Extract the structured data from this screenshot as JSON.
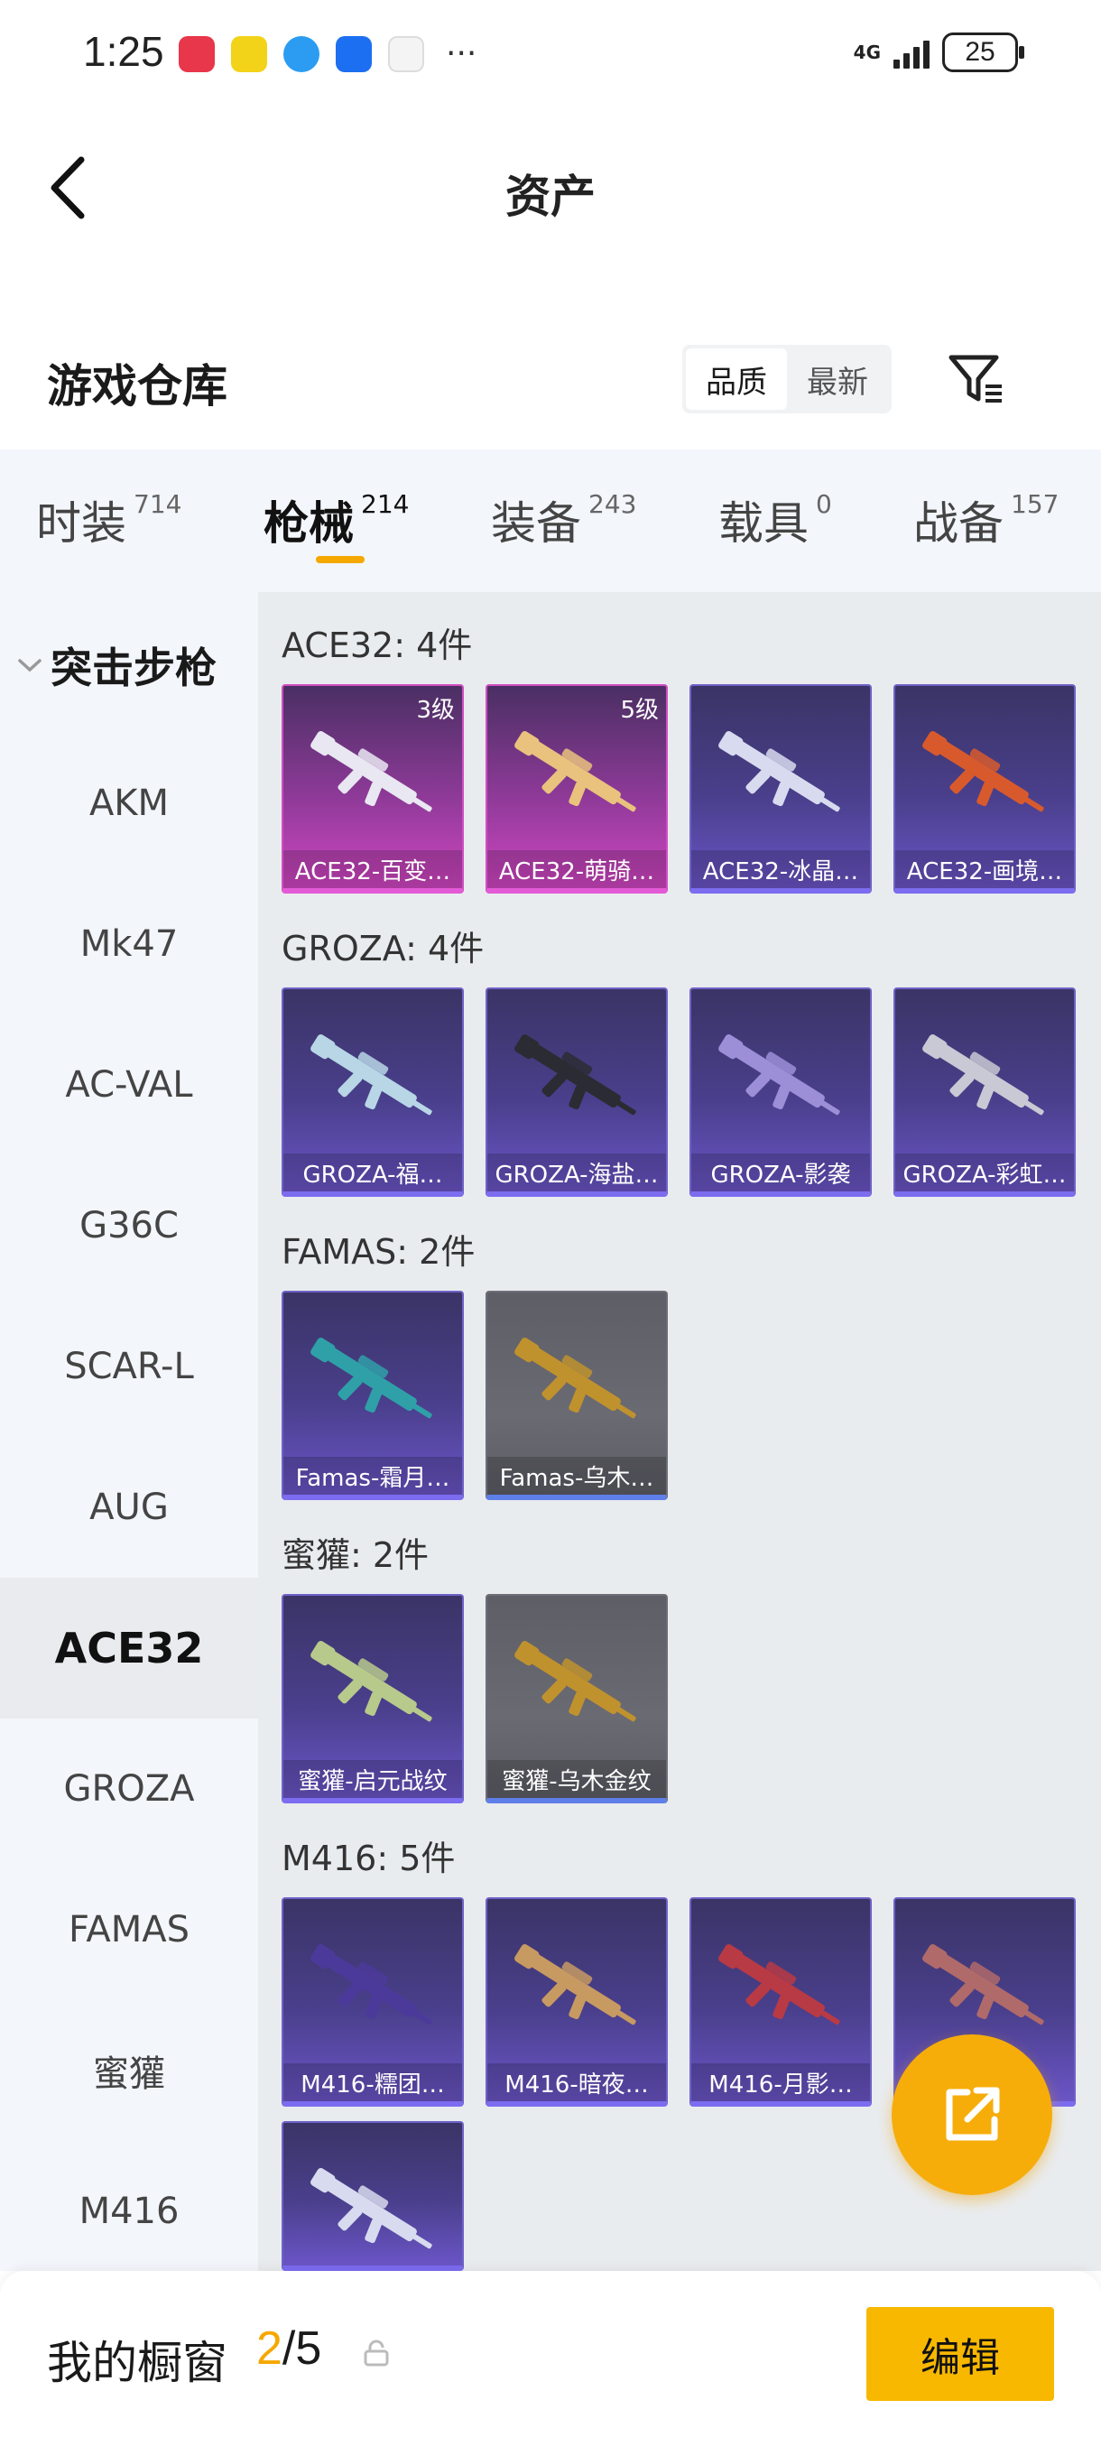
{
  "status_bar": {
    "time": "1:25",
    "network": "4G",
    "battery": "25",
    "more": "···"
  },
  "header": {
    "title": "资产"
  },
  "warehouse": {
    "title": "游戏仓库",
    "sort_options": [
      "品质",
      "最新"
    ],
    "active_sort": "品质"
  },
  "tabs": [
    {
      "label": "时装",
      "count": "714"
    },
    {
      "label": "枪械",
      "count": "214"
    },
    {
      "label": "装备",
      "count": "243"
    },
    {
      "label": "载具",
      "count": "0"
    },
    {
      "label": "战备",
      "count": "157"
    }
  ],
  "active_tab": "枪械",
  "sidebar": {
    "group_label": "突击步枪",
    "items": [
      "AKM",
      "Mk47",
      "AC-VAL",
      "G36C",
      "SCAR-L",
      "AUG",
      "ACE32",
      "GROZA",
      "FAMAS",
      "蜜獾",
      "M416"
    ],
    "active_item": "ACE32"
  },
  "groups": [
    {
      "heading": "ACE32: 4件",
      "items": [
        {
          "name": "ACE32-百变…",
          "level": "3级",
          "rarity": "pink"
        },
        {
          "name": "ACE32-萌骑…",
          "level": "5级",
          "rarity": "pink"
        },
        {
          "name": "ACE32-冰晶…",
          "level": "",
          "rarity": "purple"
        },
        {
          "name": "ACE32-画境…",
          "level": "",
          "rarity": "purple"
        }
      ]
    },
    {
      "heading": "GROZA: 4件",
      "items": [
        {
          "name": "GROZA-福…",
          "level": "",
          "rarity": "purple"
        },
        {
          "name": "GROZA-海盐…",
          "level": "",
          "rarity": "purple"
        },
        {
          "name": "GROZA-影袭",
          "level": "",
          "rarity": "purple"
        },
        {
          "name": "GROZA-彩虹…",
          "level": "",
          "rarity": "purple"
        }
      ]
    },
    {
      "heading": "FAMAS: 2件",
      "items": [
        {
          "name": "Famas-霜月…",
          "level": "",
          "rarity": "purple"
        },
        {
          "name": "Famas-乌木…",
          "level": "",
          "rarity": "gray"
        }
      ]
    },
    {
      "heading": "蜜獾: 2件",
      "items": [
        {
          "name": "蜜獾-启元战纹",
          "level": "",
          "rarity": "purple"
        },
        {
          "name": "蜜獾-乌木金纹",
          "level": "",
          "rarity": "gray"
        }
      ]
    },
    {
      "heading": "M416: 5件",
      "items": [
        {
          "name": "M416-糯团…",
          "level": "",
          "rarity": "purple"
        },
        {
          "name": "M416-暗夜…",
          "level": "",
          "rarity": "purple"
        },
        {
          "name": "M416-月影…",
          "level": "",
          "rarity": "purple"
        },
        {
          "name": "",
          "level": "",
          "rarity": "purple"
        },
        {
          "name": "",
          "level": "",
          "rarity": "purple"
        }
      ]
    }
  ],
  "showcase": {
    "label": "我的橱窗",
    "current": "2",
    "separator": "/",
    "total": "5",
    "edit_label": "编辑"
  },
  "colors": {
    "accent": "#f5a800",
    "rarity_pink": "#d146c2",
    "rarity_purple": "#6a55c6",
    "rarity_gray": "#6a6a72"
  },
  "icons": {
    "back": "back-arrow-icon",
    "filter": "filter-icon",
    "share": "share-external-icon",
    "lock": "lock-icon",
    "group_expand": "chevron-down-icon"
  }
}
